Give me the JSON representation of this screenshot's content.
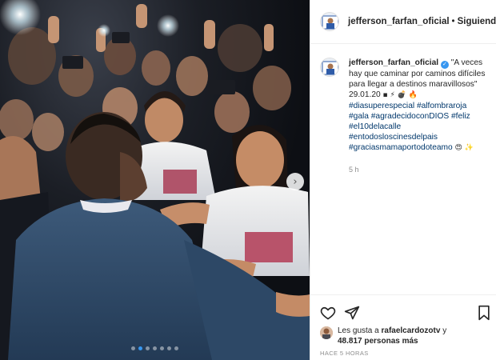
{
  "post": {
    "username": "jefferson_farfan_oficial",
    "separator": "•",
    "follow_status": "Siguiendo",
    "caption": {
      "username": "jefferson_farfan_oficial",
      "verified_glyph": "✓",
      "line1": "\"A veces hay que caminar por caminos difíciles para llegar a destinos maravillosos\"",
      "date_line": "29.01.20",
      "date_emojis": "▪ ⚡ 💣 🔥",
      "hashtags": [
        "#diasuperespecial #alfombraroja",
        "#gala #agradecidoconDIOS #feliz",
        "#el10delacalle",
        "#entodosloscinesdelpais",
        "#graciasmamaportodoteamo"
      ],
      "end_emojis": "😍 ✨",
      "time_ago": "5 h"
    },
    "likes": {
      "prefix": "Les gusta a",
      "liker": "rafaelcardozotv",
      "connector": "y",
      "count": "48.817 personas más"
    },
    "posted": "HACE 5 HORAS",
    "carousel": {
      "slides": 7,
      "active_index": 1,
      "next_glyph": "›"
    }
  },
  "icons": {
    "header_avatar": "avatar",
    "caption_avatar": "avatar",
    "like": "heart-icon",
    "share": "paper-plane-icon",
    "save": "bookmark-icon",
    "carousel_next": "chevron-right-icon"
  },
  "colors": {
    "link": "#00376b",
    "verified": "#3897f0",
    "muted": "#8e8e8e",
    "border": "#efefef"
  }
}
